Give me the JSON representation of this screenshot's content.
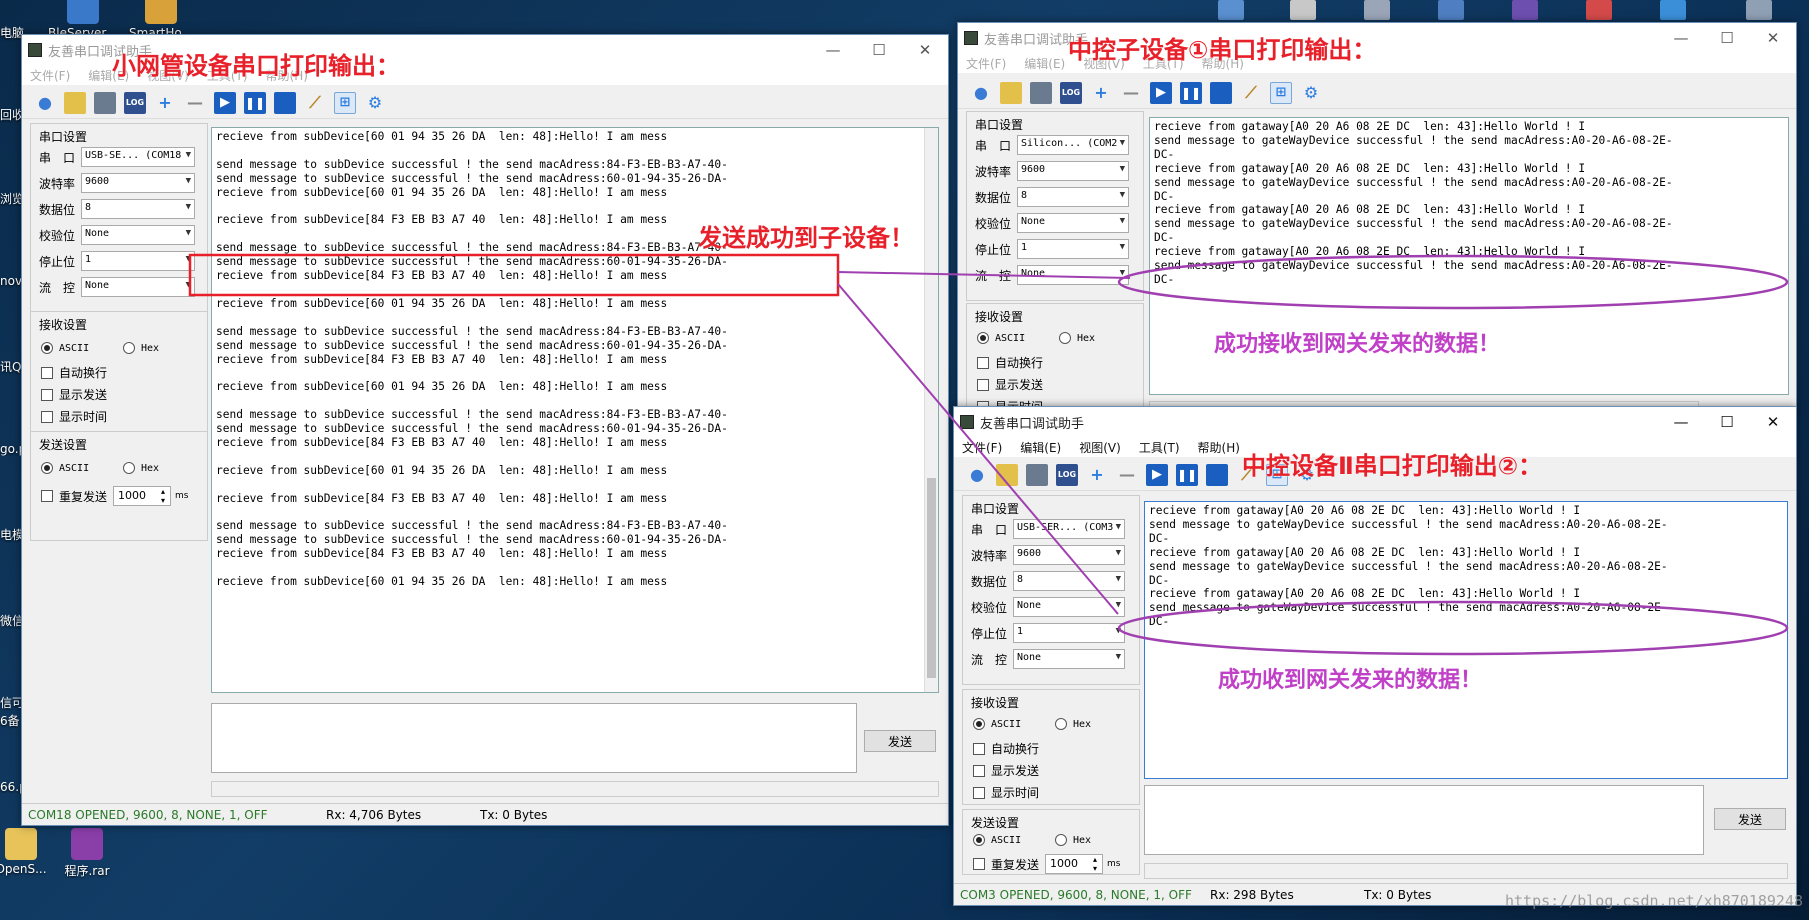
{
  "desktop": {
    "top_icons": [
      "BleServer....",
      "SmartHo..."
    ],
    "bottom_icons": [
      "OpenS...",
      "程序.rar"
    ],
    "left_strip": [
      "电脑",
      "回收",
      "浏览",
      "nov",
      "讯Q",
      "go.p",
      "电模",
      "微信",
      "信可",
      "6备",
      "66.p"
    ]
  },
  "common": {
    "menu": [
      "文件(F)",
      "编辑(E)",
      "视图(V)",
      "工具(T)",
      "帮助(H)"
    ],
    "serial_title": "串口设置",
    "lbl_port": "串　口",
    "lbl_baud": "波特率",
    "lbl_data": "数据位",
    "lbl_parity": "校验位",
    "lbl_stop": "停止位",
    "lbl_flow": "流　控",
    "baud": "9600",
    "databits": "8",
    "parity": "None",
    "stopbits": "1",
    "flow": "None",
    "recv_title": "接收设置",
    "ascii": "ASCII",
    "hex": "Hex",
    "auto_wrap": "自动换行",
    "show_send": "显示发送",
    "show_time": "显示时间",
    "send_title": "发送设置",
    "repeat_send": "重复发送",
    "interval": "1000",
    "ms": "ms",
    "send_btn": "发送"
  },
  "win1": {
    "title": "友善串口调试助手",
    "port": "USB-SE... (COM18",
    "status": "COM18 OPENED, 9600, 8, NONE, 1, OFF",
    "rx": "Rx: 4,706 Bytes",
    "tx": "Tx: 0 Bytes",
    "log": "recieve from subDevice[60 01 94 35 26 DA  len: 48]:Hello! I am mess\n\nsend message to subDevice successful ! the send macAdress:84-F3-EB-B3-A7-40-\nsend message to subDevice successful ! the send macAdress:60-01-94-35-26-DA-\nrecieve from subDevice[60 01 94 35 26 DA  len: 48]:Hello! I am mess\n\nrecieve from subDevice[84 F3 EB B3 A7 40  len: 48]:Hello! I am mess\n\nsend message to subDevice successful ! the send macAdress:84-F3-EB-B3-A7-40-\nsend message to subDevice successful ! the send macAdress:60-01-94-35-26-DA-\nrecieve from subDevice[84 F3 EB B3 A7 40  len: 48]:Hello! I am mess\n\nrecieve from subDevice[60 01 94 35 26 DA  len: 48]:Hello! I am mess\n\nsend message to subDevice successful ! the send macAdress:84-F3-EB-B3-A7-40-\nsend message to subDevice successful ! the send macAdress:60-01-94-35-26-DA-\nrecieve from subDevice[84 F3 EB B3 A7 40  len: 48]:Hello! I am mess\n\nrecieve from subDevice[60 01 94 35 26 DA  len: 48]:Hello! I am mess\n\nsend message to subDevice successful ! the send macAdress:84-F3-EB-B3-A7-40-\nsend message to subDevice successful ! the send macAdress:60-01-94-35-26-DA-\nrecieve from subDevice[84 F3 EB B3 A7 40  len: 48]:Hello! I am mess\n\nrecieve from subDevice[60 01 94 35 26 DA  len: 48]:Hello! I am mess\n\nrecieve from subDevice[84 F3 EB B3 A7 40  len: 48]:Hello! I am mess\n\nsend message to subDevice successful ! the send macAdress:84-F3-EB-B3-A7-40-\nsend message to subDevice successful ! the send macAdress:60-01-94-35-26-DA-\nrecieve from subDevice[84 F3 EB B3 A7 40  len: 48]:Hello! I am mess\n\nrecieve from subDevice[60 01 94 35 26 DA  len: 48]:Hello! I am mess"
  },
  "win2": {
    "title": "友善串口调试助手",
    "port": "Silicon... (COM2",
    "log": "recieve from gataway[A0 20 A6 08 2E DC  len: 43]:Hello World ! I\nsend message to gateWayDevice successful ! the send macAdress:A0-20-A6-08-2E-\nDC-\nrecieve from gataway[A0 20 A6 08 2E DC  len: 43]:Hello World ! I\nsend message to gateWayDevice successful ! the send macAdress:A0-20-A6-08-2E-\nDC-\nrecieve from gataway[A0 20 A6 08 2E DC  len: 43]:Hello World ! I\nsend message to gateWayDevice successful ! the send macAdress:A0-20-A6-08-2E-\nDC-\nrecieve from gataway[A0 20 A6 08 2E DC  len: 43]:Hello World ! I\nsend message to gateWayDevice successful ! the send macAdress:A0-20-A6-08-2E-\nDC-"
  },
  "win3": {
    "title": "友善串口调试助手",
    "port": "USB-SER... (COM3",
    "status": "COM3 OPENED, 9600, 8, NONE, 1, OFF",
    "rx": "Rx: 298 Bytes",
    "tx": "Tx: 0 Bytes",
    "log": "recieve from gataway[A0 20 A6 08 2E DC  len: 43]:Hello World ! I\nsend message to gateWayDevice successful ! the send macAdress:A0-20-A6-08-2E-\nDC-\nrecieve from gataway[A0 20 A6 08 2E DC  len: 43]:Hello World ! I\nsend message to gateWayDevice successful ! the send macAdress:A0-20-A6-08-2E-\nDC-\nrecieve from gataway[A0 20 A6 08 2E DC  len: 43]:Hello World ! I\nsend message to gateWayDevice successful ! the send macAdress:A0-20-A6-08-2E-\nDC-"
  },
  "annotations": {
    "a1": "小网管设备串口打印输出：",
    "a2": "中控子设备①串口打印输出：",
    "a3": "中控设备Ⅱ串口打印输出②：",
    "a4": "发送成功到子设备！",
    "a5": "成功接收到网关发来的数据！",
    "a6": "成功收到网关发来的数据！"
  },
  "watermark": "https://blog.csdn.net/xh870189248",
  "colors": {
    "annotation_red": "#e8202a",
    "annotation_purple": "#c040c8",
    "play_blue": "#1a5fc0"
  }
}
